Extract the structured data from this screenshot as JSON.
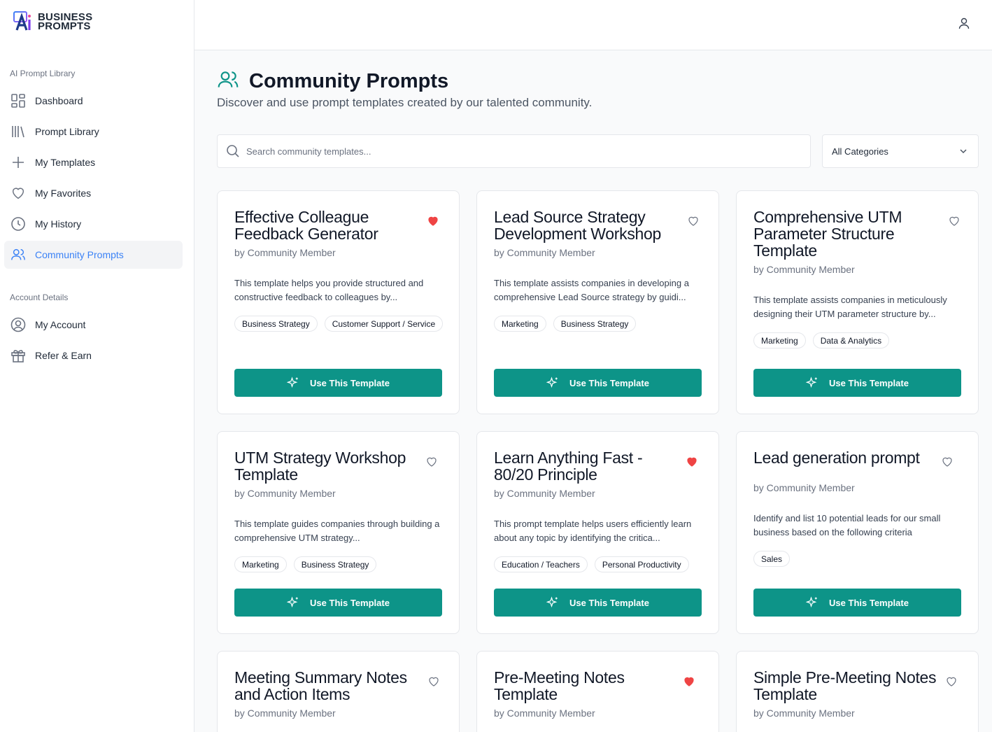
{
  "brand": {
    "line1": "BUSINESS",
    "line2": "PROMPTS"
  },
  "sidebar": {
    "section1": "AI Prompt Library",
    "items": [
      {
        "label": "Dashboard",
        "icon": "grid-icon"
      },
      {
        "label": "Prompt Library",
        "icon": "library-icon"
      },
      {
        "label": "My Templates",
        "icon": "plus-icon"
      },
      {
        "label": "My Favorites",
        "icon": "heart-icon"
      },
      {
        "label": "My History",
        "icon": "clock-icon"
      },
      {
        "label": "Community Prompts",
        "icon": "users-icon",
        "active": true
      }
    ],
    "section2": "Account Details",
    "account_items": [
      {
        "label": "My Account",
        "icon": "user-circle-icon"
      },
      {
        "label": "Refer & Earn",
        "icon": "gift-icon"
      }
    ]
  },
  "page": {
    "title": "Community Prompts",
    "subtitle": "Discover and use prompt templates created by our talented community."
  },
  "search": {
    "placeholder": "Search community templates..."
  },
  "category": {
    "selected": "All Categories"
  },
  "cards": [
    {
      "title": "Effective Colleague Feedback Generator",
      "author": "by Community Member",
      "favorited": true,
      "description": "This template helps you provide structured and constructive feedback to colleagues by...",
      "tags": [
        "Business Strategy",
        "Customer Support / Service"
      ],
      "button": "Use This Template"
    },
    {
      "title": "Lead Source Strategy Development Workshop",
      "author": "by Community Member",
      "favorited": false,
      "description": "This template assists companies in developing a comprehensive Lead Source strategy by guidi...",
      "tags": [
        "Marketing",
        "Business Strategy"
      ],
      "button": "Use This Template"
    },
    {
      "title": "Comprehensive UTM Parameter Structure Template",
      "author": "by Community Member",
      "favorited": false,
      "description": "This template assists companies in meticulously designing their UTM parameter structure by...",
      "tags": [
        "Marketing",
        "Data & Analytics"
      ],
      "button": "Use This Template"
    },
    {
      "title": "UTM Strategy Workshop Template",
      "author": "by Community Member",
      "favorited": false,
      "description": "This template guides companies through building a comprehensive UTM strategy...",
      "tags": [
        "Marketing",
        "Business Strategy"
      ],
      "button": "Use This Template"
    },
    {
      "title": "Learn Anything Fast - 80/20 Principle",
      "author": "by Community Member",
      "favorited": true,
      "description": "This prompt template helps users efficiently learn about any topic by identifying the critica...",
      "tags": [
        "Education / Teachers",
        "Personal Productivity"
      ],
      "button": "Use This Template"
    },
    {
      "title": "Lead generation prompt",
      "author": "by Community Member",
      "favorited": false,
      "description": "Identify and list 10 potential leads for our small business based on the following criteria",
      "tags": [
        "Sales"
      ],
      "button": "Use This Template"
    },
    {
      "title": "Meeting Summary Notes and Action Items",
      "author": "by Community Member",
      "favorited": false
    },
    {
      "title": "Pre-Meeting Notes Template",
      "author": "by Community Member",
      "favorited": true
    },
    {
      "title": "Simple Pre-Meeting Notes Template",
      "author": "by Community Member",
      "favorited": false
    }
  ],
  "colors": {
    "accent": "#0d9488",
    "active_nav": "#3b82f6",
    "heart": "#ef4444"
  }
}
